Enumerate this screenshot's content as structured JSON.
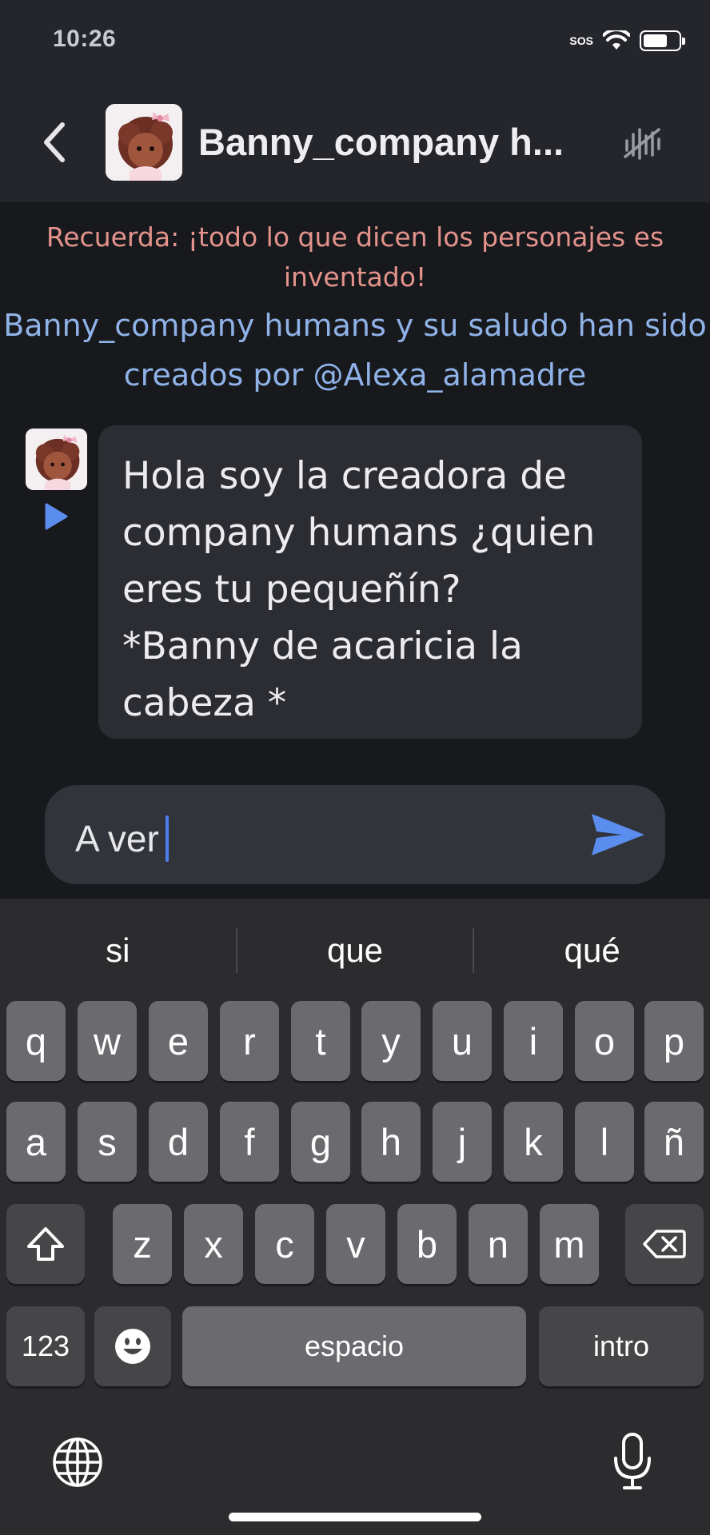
{
  "status": {
    "time": "10:26",
    "sos": "SOS"
  },
  "header": {
    "title": "Banny_company h..."
  },
  "notices": {
    "warning": "Recuerda: ¡todo lo que dicen los personajes es inventado!",
    "credit": "Banny_company humans y su saludo han sido creados por @Alexa_alamadre"
  },
  "message": {
    "text": "Hola soy la creadora de\ncompany humans ¿quien\neres tu pequeñín?\n*Banny de acaricia la\ncabeza *"
  },
  "composer": {
    "value": "A ver"
  },
  "keyboard": {
    "suggestions": [
      "si",
      "que",
      "qué"
    ],
    "row1": [
      "q",
      "w",
      "e",
      "r",
      "t",
      "y",
      "u",
      "i",
      "o",
      "p"
    ],
    "row2": [
      "a",
      "s",
      "d",
      "f",
      "g",
      "h",
      "j",
      "k",
      "l",
      "ñ"
    ],
    "row3": [
      "z",
      "x",
      "c",
      "v",
      "b",
      "n",
      "m"
    ],
    "numbers_key": "123",
    "space_key": "espacio",
    "return_key": "intro"
  },
  "icons": {
    "back": "chevron-left-icon",
    "mute": "waveform-slash-icon",
    "play": "play-icon",
    "send": "send-icon",
    "shift": "shift-icon",
    "delete": "backspace-icon",
    "emoji": "emoji-icon",
    "globe": "globe-icon",
    "mic": "microphone-icon"
  },
  "colors": {
    "warning": "#e3938c",
    "credit": "#8fb3e8",
    "accent": "#5b8def"
  }
}
